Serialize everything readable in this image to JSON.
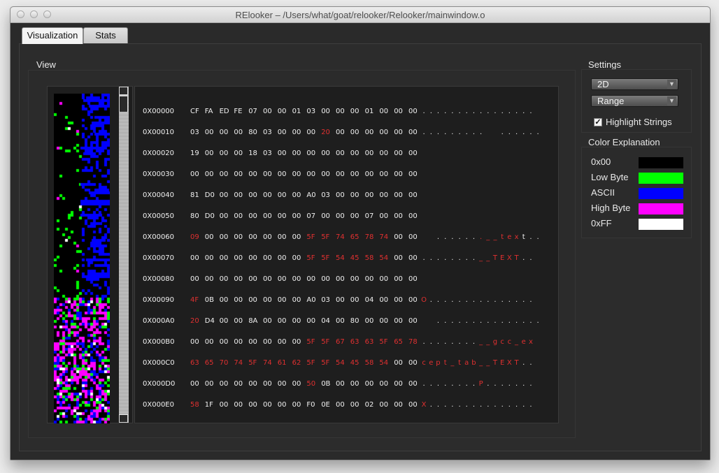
{
  "window": {
    "title": "RElooker – /Users/what/goat/relooker/Relooker/mainwindow.o",
    "controls": [
      "close-button",
      "minimize-button",
      "zoom-button"
    ]
  },
  "tabs": [
    {
      "label": "Visualization",
      "active": true
    },
    {
      "label": "Stats",
      "active": false
    }
  ],
  "view": {
    "label": "View",
    "rows": [
      {
        "addr": "0X00000",
        "bytes": [
          "CF",
          "FA",
          "ED",
          "FE",
          "07",
          "00",
          "00",
          "01",
          "03",
          "00",
          "00",
          "00",
          "01",
          "00",
          "00",
          "00"
        ],
        "red": [],
        "chars": ". . . . . . . . . . . . . . . .",
        "redchars": []
      },
      {
        "addr": "0X00010",
        "bytes": [
          "03",
          "00",
          "00",
          "00",
          "80",
          "03",
          "00",
          "00",
          "00",
          "20",
          "00",
          "00",
          "00",
          "00",
          "00",
          "00"
        ],
        "red": [
          9
        ],
        "chars": ". . . . . . . . .   . . . . . .",
        "redchars": []
      },
      {
        "addr": "0X00020",
        "bytes": [
          "19",
          "00",
          "00",
          "00",
          "18",
          "03",
          "00",
          "00",
          "00",
          "00",
          "00",
          "00",
          "00",
          "00",
          "00",
          "00"
        ],
        "red": [],
        "chars": "",
        "redchars": []
      },
      {
        "addr": "0X00030",
        "bytes": [
          "00",
          "00",
          "00",
          "00",
          "00",
          "00",
          "00",
          "00",
          "00",
          "00",
          "00",
          "00",
          "00",
          "00",
          "00",
          "00"
        ],
        "red": [],
        "chars": "",
        "redchars": []
      },
      {
        "addr": "0X00040",
        "bytes": [
          "81",
          "D0",
          "00",
          "00",
          "00",
          "00",
          "00",
          "00",
          "A0",
          "03",
          "00",
          "00",
          "00",
          "00",
          "00",
          "00"
        ],
        "red": [],
        "chars": "",
        "redchars": []
      },
      {
        "addr": "0X00050",
        "bytes": [
          "80",
          "D0",
          "00",
          "00",
          "00",
          "00",
          "00",
          "00",
          "07",
          "00",
          "00",
          "00",
          "07",
          "00",
          "00",
          "00"
        ],
        "red": [],
        "chars": "",
        "redchars": []
      },
      {
        "addr": "0X00060",
        "bytes": [
          "09",
          "00",
          "00",
          "00",
          "00",
          "00",
          "00",
          "00",
          "5F",
          "5F",
          "74",
          "65",
          "78",
          "74",
          "00",
          "00"
        ],
        "red": [
          0,
          8,
          9,
          10,
          11,
          12,
          13
        ],
        "chars": "  . . . . . . . _ _ t e x t . .",
        "redchars": [
          8,
          9,
          10,
          11,
          12,
          13
        ]
      },
      {
        "addr": "0X00070",
        "bytes": [
          "00",
          "00",
          "00",
          "00",
          "00",
          "00",
          "00",
          "00",
          "5F",
          "5F",
          "54",
          "45",
          "58",
          "54",
          "00",
          "00"
        ],
        "red": [
          8,
          9,
          10,
          11,
          12,
          13
        ],
        "chars": ". . . . . . . . _ _ T E X T . .",
        "redchars": [
          8,
          9,
          10,
          11,
          12,
          13
        ]
      },
      {
        "addr": "0X00080",
        "bytes": [
          "00",
          "00",
          "00",
          "00",
          "00",
          "00",
          "00",
          "00",
          "00",
          "00",
          "00",
          "00",
          "00",
          "00",
          "00",
          "00"
        ],
        "red": [],
        "chars": "",
        "redchars": []
      },
      {
        "addr": "0X00090",
        "bytes": [
          "4F",
          "0B",
          "00",
          "00",
          "00",
          "00",
          "00",
          "00",
          "A0",
          "03",
          "00",
          "00",
          "04",
          "00",
          "00",
          "00"
        ],
        "red": [
          0
        ],
        "chars": "O . . . . . . . . . . . . . . .",
        "redchars": [
          0
        ]
      },
      {
        "addr": "0X000A0",
        "bytes": [
          "20",
          "D4",
          "00",
          "00",
          "8A",
          "00",
          "00",
          "00",
          "00",
          "04",
          "00",
          "80",
          "00",
          "00",
          "00",
          "00"
        ],
        "red": [
          0
        ],
        "chars": "  . . . . . . . . . . . . . . .",
        "redchars": []
      },
      {
        "addr": "0X000B0",
        "bytes": [
          "00",
          "00",
          "00",
          "00",
          "00",
          "00",
          "00",
          "00",
          "5F",
          "5F",
          "67",
          "63",
          "63",
          "5F",
          "65",
          "78"
        ],
        "red": [
          8,
          9,
          10,
          11,
          12,
          13,
          14,
          15
        ],
        "chars": ". . . . . . . . _ _ g c c _ e x",
        "redchars": [
          8,
          9,
          10,
          11,
          12,
          13,
          14,
          15
        ]
      },
      {
        "addr": "0X000C0",
        "bytes": [
          "63",
          "65",
          "70",
          "74",
          "5F",
          "74",
          "61",
          "62",
          "5F",
          "5F",
          "54",
          "45",
          "58",
          "54",
          "00",
          "00"
        ],
        "red": [
          0,
          1,
          2,
          3,
          4,
          5,
          6,
          7,
          8,
          9,
          10,
          11,
          12,
          13
        ],
        "chars": "c e p t _ t a b _ _ T E X T . .",
        "redchars": [
          0,
          1,
          2,
          3,
          4,
          5,
          6,
          7,
          8,
          9,
          10,
          11,
          12,
          13
        ]
      },
      {
        "addr": "0X000D0",
        "bytes": [
          "00",
          "00",
          "00",
          "00",
          "00",
          "00",
          "00",
          "00",
          "50",
          "0B",
          "00",
          "00",
          "00",
          "00",
          "00",
          "00"
        ],
        "red": [
          8
        ],
        "chars": ". . . . . . . . P . . . . . . .",
        "redchars": [
          8
        ]
      },
      {
        "addr": "0X000E0",
        "bytes": [
          "58",
          "1F",
          "00",
          "00",
          "00",
          "00",
          "00",
          "00",
          "F0",
          "0E",
          "00",
          "00",
          "02",
          "00",
          "00",
          "00"
        ],
        "red": [
          0
        ],
        "chars": "X . . . . . . . . . . . . . . .",
        "redchars": [
          0
        ]
      }
    ]
  },
  "settings": {
    "label": "Settings",
    "mode": "2D",
    "scheme": "Range",
    "highlight_strings_label": "Highlight Strings",
    "highlight_strings": true
  },
  "legend": {
    "label": "Color Explanation",
    "items": [
      {
        "label": "0x00",
        "color": "#000000"
      },
      {
        "label": "Low Byte",
        "color": "#00ff00"
      },
      {
        "label": "ASCII",
        "color": "#0000ff"
      },
      {
        "label": "High Byte",
        "color": "#ff00ff"
      },
      {
        "label": "0xFF",
        "color": "#ffffff"
      }
    ]
  }
}
